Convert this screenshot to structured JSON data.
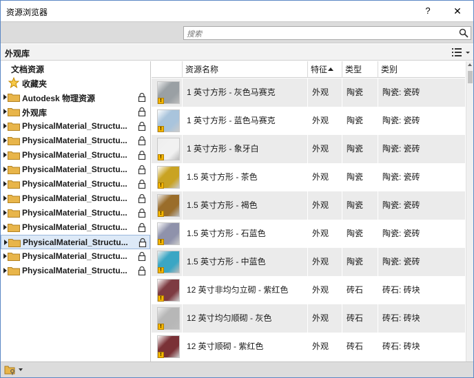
{
  "window": {
    "title": "资源浏览器",
    "help_label": "?",
    "close_label": "✕"
  },
  "search": {
    "placeholder": "搜索"
  },
  "library": {
    "title": "外观库"
  },
  "tree": {
    "items": [
      {
        "label": "文档资源",
        "kind": "header",
        "locked": false
      },
      {
        "label": "收藏夹",
        "kind": "favorites",
        "locked": false
      },
      {
        "label": "Autodesk 物理资源",
        "kind": "folder",
        "locked": true
      },
      {
        "label": "外观库",
        "kind": "folder",
        "locked": true
      },
      {
        "label": "PhysicalMaterial_Structu...",
        "kind": "folder",
        "locked": true
      },
      {
        "label": "PhysicalMaterial_Structu...",
        "kind": "folder",
        "locked": true
      },
      {
        "label": "PhysicalMaterial_Structu...",
        "kind": "folder",
        "locked": true
      },
      {
        "label": "PhysicalMaterial_Structu...",
        "kind": "folder",
        "locked": true
      },
      {
        "label": "PhysicalMaterial_Structu...",
        "kind": "folder",
        "locked": true
      },
      {
        "label": "PhysicalMaterial_Structu...",
        "kind": "folder",
        "locked": true
      },
      {
        "label": "PhysicalMaterial_Structu...",
        "kind": "folder",
        "locked": true
      },
      {
        "label": "PhysicalMaterial_Structu...",
        "kind": "folder",
        "locked": true
      },
      {
        "label": "PhysicalMaterial_Structu...",
        "kind": "folder",
        "locked": true,
        "selected": true
      },
      {
        "label": "PhysicalMaterial_Structu...",
        "kind": "folder",
        "locked": true
      },
      {
        "label": "PhysicalMaterial_Structu...",
        "kind": "folder",
        "locked": true
      }
    ]
  },
  "table": {
    "columns": [
      "资源名称",
      "特征",
      "类型",
      "类别"
    ],
    "rows": [
      {
        "name": "1 英寸方形 - 灰色马赛克",
        "feature": "外观",
        "type": "陶瓷",
        "category": "陶瓷: 瓷砖",
        "swatch": "#9aa0a4"
      },
      {
        "name": "1 英寸方形 - 蓝色马赛克",
        "feature": "外观",
        "type": "陶瓷",
        "category": "陶瓷: 瓷砖",
        "swatch": "#a9c4dc"
      },
      {
        "name": "1 英寸方形 - 象牙白",
        "feature": "外观",
        "type": "陶瓷",
        "category": "陶瓷: 瓷砖",
        "swatch": "#f1f1f1"
      },
      {
        "name": "1.5 英寸方形 - 茶色",
        "feature": "外观",
        "type": "陶瓷",
        "category": "陶瓷: 瓷砖",
        "swatch": "#c9a322"
      },
      {
        "name": "1.5 英寸方形 - 褐色",
        "feature": "外观",
        "type": "陶瓷",
        "category": "陶瓷: 瓷砖",
        "swatch": "#9a6d2a"
      },
      {
        "name": "1.5 英寸方形 - 石蓝色",
        "feature": "外观",
        "type": "陶瓷",
        "category": "陶瓷: 瓷砖",
        "swatch": "#8f92ab"
      },
      {
        "name": "1.5 英寸方形 - 中蓝色",
        "feature": "外观",
        "type": "陶瓷",
        "category": "陶瓷: 瓷砖",
        "swatch": "#3aa6c4"
      },
      {
        "name": "12 英寸非均匀立砌 - 紫红色",
        "feature": "外观",
        "type": "砖石",
        "category": "砖石: 砖块",
        "swatch": "#7e3b42"
      },
      {
        "name": "12 英寸均匀顺砌 - 灰色",
        "feature": "外观",
        "type": "砖石",
        "category": "砖石: 砖块",
        "swatch": "#b7b7b7"
      },
      {
        "name": "12 英寸顺砌 - 紫红色",
        "feature": "外观",
        "type": "砖石",
        "category": "砖石: 砖块",
        "swatch": "#7a3136"
      }
    ]
  },
  "colors": {
    "accent": "#5a87c4",
    "selection": "#dde9f7",
    "folder": "#e8b54a",
    "warning": "#f4b400"
  },
  "icons": {
    "search": "search-icon",
    "view_toggle": "list-view-icon",
    "folder": "folder-icon",
    "lock": "lock-icon",
    "star": "star-icon",
    "manage": "manage-library-icon"
  }
}
